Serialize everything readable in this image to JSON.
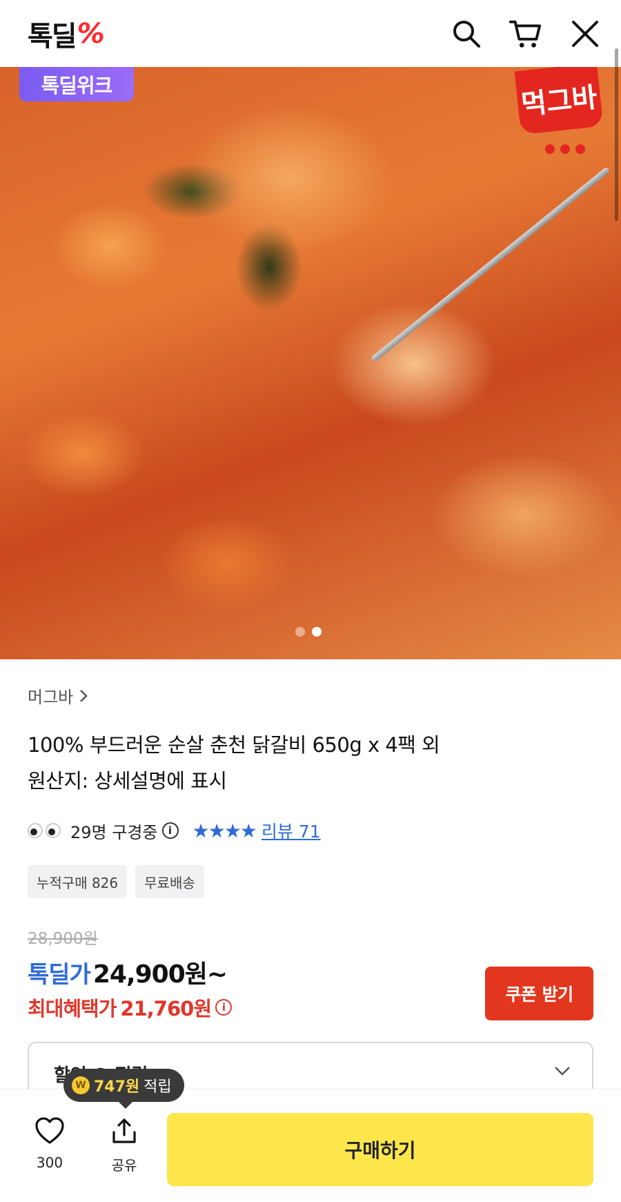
{
  "header": {
    "logo_text": "톡딜",
    "logo_mark": "%",
    "icons": [
      "search-icon",
      "cart-icon",
      "close-icon"
    ]
  },
  "hero": {
    "badge": "톡딜위크",
    "brand_logo_text": "먹그바",
    "slide_count": 2,
    "active_slide": 2,
    "colors": {
      "badge": "#8a63f5",
      "brand": "#e3261f"
    }
  },
  "product": {
    "brand": "머그바",
    "title_line1": "100% 부드러운 순살 춘천 닭갈비 650g x 4팩 외",
    "title_line2": "원산지: 상세설명에 표시",
    "viewers": "29명 구경중",
    "rating_stars": 4,
    "review_label": "리뷰 71",
    "tags": [
      "누적구매 826",
      "무료배송"
    ]
  },
  "price": {
    "original": "28,900원",
    "deal_label": "톡딜가",
    "deal_price": "24,900원~",
    "max_label": "최대혜택가",
    "max_price": "21,760원",
    "coupon_button": "쿠폰 받기",
    "colors": {
      "deal": "#2d6bd6",
      "benefit": "#e0372a"
    }
  },
  "discount": {
    "label": "할인 & 적립"
  },
  "points_tip": {
    "coin_symbol": "W",
    "amount": "747원",
    "suffix": "적립"
  },
  "bottom_bar": {
    "like_count": "300",
    "share_label": "공유",
    "buy_label": "구매하기",
    "buy_color": "#fde64b"
  }
}
